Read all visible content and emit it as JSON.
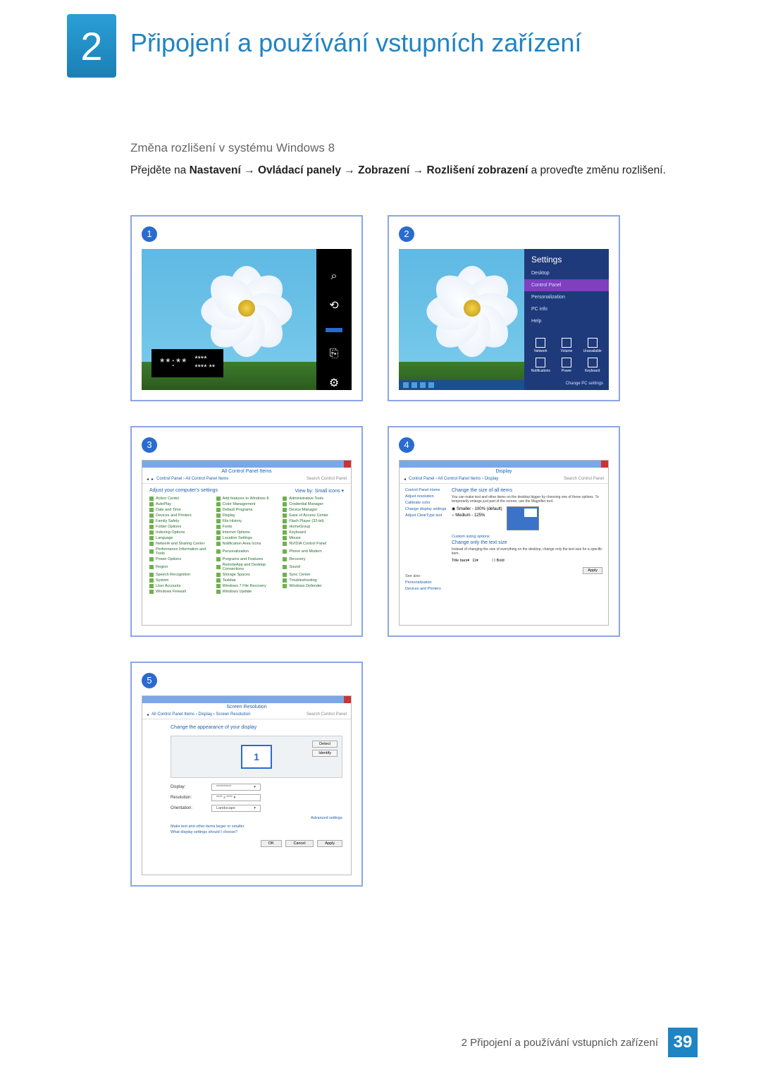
{
  "header": {
    "chapter_number": "2",
    "title": "Připojení a používání vstupních zařízení"
  },
  "section": {
    "subheading": "Změna rozlišení v systému Windows 8",
    "instruction_prefix": "Přejděte na ",
    "path_1": "Nastavení",
    "path_2": "Ovládací panely",
    "path_3": "Zobrazení",
    "path_4": "Rozlišení zobrazení",
    "instruction_suffix": " a proveďte změnu rozlišení.",
    "arrow": "→"
  },
  "badges": {
    "s1": "1",
    "s2": "2",
    "s3": "3",
    "s4": "4",
    "s5": "5"
  },
  "shot1": {
    "time_masked_big": "**:**",
    "time_masked_small_line1": "****",
    "time_masked_small_line2": "**** **",
    "charms": [
      "Search",
      "Share",
      "Start",
      "Devices",
      "Settings"
    ]
  },
  "shot2": {
    "panel_title": "Settings",
    "links": [
      "Desktop",
      "Control Panel",
      "Personalization",
      "PC info",
      "Help"
    ],
    "grid": [
      "Network",
      "Volume",
      "Unavailable",
      "Notifications",
      "Power",
      "Keyboard"
    ],
    "footer": "Change PC settings"
  },
  "shot3": {
    "window_title": "All Control Panel Items",
    "breadcrumb": "Control Panel › All Control Panel Items",
    "search_placeholder": "Search Control Panel",
    "heading": "Adjust your computer's settings",
    "viewby": "View by:   Small icons ▾",
    "items": [
      "Action Center",
      "Add features to Windows 8",
      "Administrative Tools",
      "AutoPlay",
      "Color Management",
      "Credential Manager",
      "Date and Time",
      "Default Programs",
      "Device Manager",
      "Devices and Printers",
      "Display",
      "Ease of Access Center",
      "Family Safety",
      "File History",
      "Flash Player (32-bit)",
      "Folder Options",
      "Fonts",
      "HomeGroup",
      "Indexing Options",
      "Internet Options",
      "Keyboard",
      "Language",
      "Location Settings",
      "Mouse",
      "Network and Sharing Center",
      "Notification Area Icons",
      "NVIDIA Control Panel",
      "Performance Information and Tools",
      "Personalization",
      "Phone and Modem",
      "Power Options",
      "Programs and Features",
      "Recovery",
      "Region",
      "RemoteApp and Desktop Connections",
      "Sound",
      "Speech Recognition",
      "Storage Spaces",
      "Sync Center",
      "System",
      "Taskbar",
      "Troubleshooting",
      "User Accounts",
      "Windows 7 File Recovery",
      "Windows Defender",
      "Windows Firewall",
      "Windows Update"
    ]
  },
  "shot4": {
    "window_title": "Display",
    "breadcrumb": "Control Panel › All Control Panel Items › Display",
    "search_placeholder": "Search Control Panel",
    "side_links": [
      "Control Panel Home",
      "Adjust resolution",
      "Calibrate color",
      "Change display settings",
      "Adjust ClearType text"
    ],
    "h1": "Change the size of all items",
    "p1": "You can make text and other items on the desktop bigger by choosing one of these options. To temporarily enlarge just part of the screen, use the Magnifier tool.",
    "opt_small": "Smaller - 100% (default)",
    "opt_medium": "Medium - 125%",
    "link_custom": "Custom sizing options",
    "h2": "Change only the text size",
    "p2": "Instead of changing the size of everything on the desktop, change only the text size for a specific item.",
    "combo_label": "Title bars",
    "combo_size": "11",
    "bold_label": "Bold",
    "apply": "Apply",
    "seealso_title": "See also",
    "seealso": [
      "Personalization",
      "Devices and Printers"
    ]
  },
  "shot5": {
    "window_title": "Screen Resolution",
    "breadcrumb": "All Control Panel Items › Display › Screen Resolution",
    "search_placeholder": "Search Control Panel",
    "heading": "Change the appearance of your display",
    "monitor_id": "1",
    "btn_detect": "Detect",
    "btn_identify": "Identify",
    "field_display": "Display:",
    "val_display": "**********",
    "field_resolution": "Resolution:",
    "val_resolution": "**** x **** ▾",
    "field_orientation": "Orientation:",
    "val_orientation": "Landscape",
    "advanced": "Advanced settings",
    "link1": "Make text and other items larger or smaller",
    "link2": "What display settings should I choose?",
    "btn_ok": "OK",
    "btn_cancel": "Cancel",
    "btn_apply": "Apply"
  },
  "footer": {
    "text": "2 Připojení a používání vstupních zařízení",
    "page": "39"
  }
}
